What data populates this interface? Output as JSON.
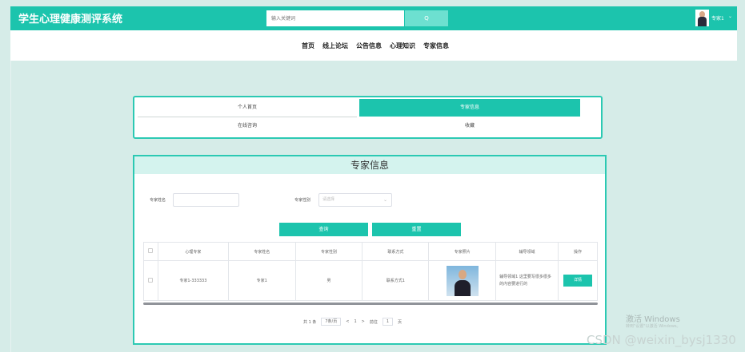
{
  "header": {
    "app_title": "学生心理健康测评系统",
    "search_placeholder": "输入关键词",
    "search_button": "Q",
    "username": "专家1",
    "caret": "⌄"
  },
  "nav": {
    "items": [
      "首页",
      "线上论坛",
      "公告信息",
      "心理知识",
      "专家信息"
    ]
  },
  "tabs": {
    "personal": "个人首页",
    "expert": "专家信息",
    "consult": "在线咨询",
    "favorites": "收藏"
  },
  "panel": {
    "title": "专家信息",
    "filters": {
      "name_label": "专家姓名",
      "name_value": "",
      "gender_label": "专家性别",
      "gender_placeholder": "请选择",
      "select_caret": "⌄"
    },
    "buttons": {
      "query": "查询",
      "reset": "重置"
    },
    "table": {
      "columns": [
        "心理专家",
        "专家姓名",
        "专家性别",
        "联系方式",
        "专家照片",
        "辅导领域",
        "操作"
      ],
      "rows": [
        {
          "account": "专家1-333333",
          "name": "专家1",
          "gender": "男",
          "contact": "联系方式1",
          "field": "辅导领域1 这里要写很多很多的内容要进行的",
          "action": "详情"
        }
      ]
    },
    "pagination": {
      "total": "共 1 条",
      "page_size": "7条/页",
      "prev": "<",
      "current": "1",
      "next": ">",
      "goto_label": "前往",
      "goto_value": "1",
      "goto_suffix": "页"
    }
  },
  "watermark": {
    "activate": "激活 Windows",
    "activate_sub": "转到\"设置\"以激活 Windows。",
    "csdn": "CSDN @weixin_bysj1330"
  },
  "colors": {
    "accent": "#1cc4ad",
    "page_bg": "#d6ece8",
    "panel_header": "#d4f3ee"
  }
}
